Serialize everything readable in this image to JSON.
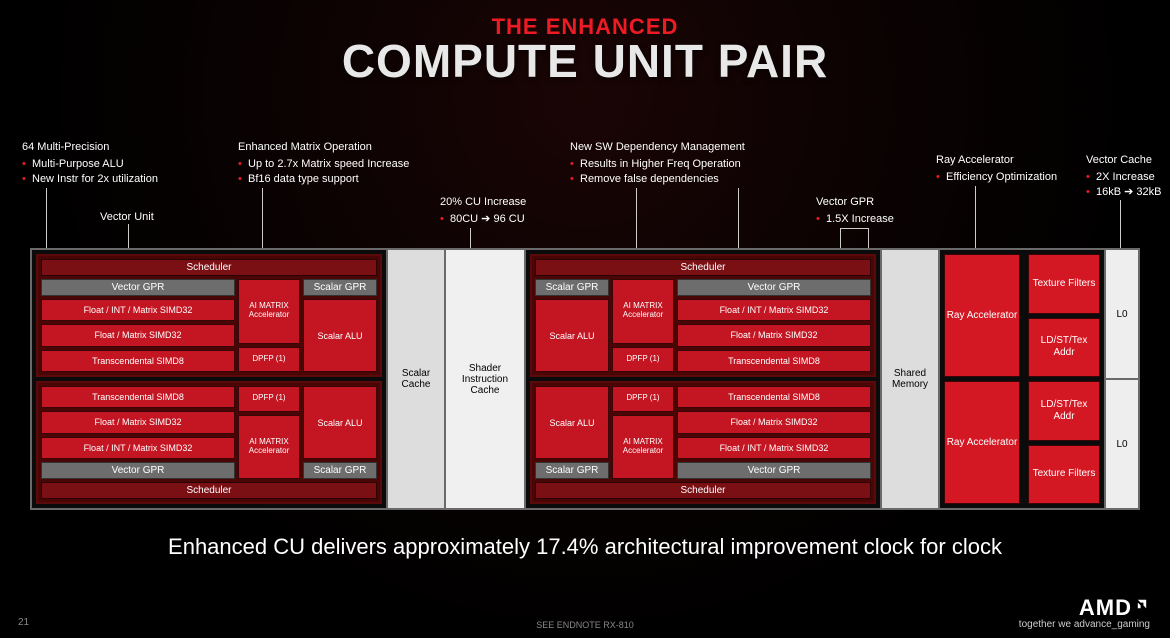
{
  "title": {
    "line1": "THE ENHANCED",
    "line2": "COMPUTE UNIT PAIR"
  },
  "annotations": {
    "alu": {
      "heading": "64 Multi-Precision",
      "items": [
        "Multi-Purpose ALU",
        "New Instr for 2x utilization"
      ]
    },
    "vector_unit": "Vector Unit",
    "matrix": {
      "heading": "Enhanced Matrix Operation",
      "items": [
        "Up to 2.7x Matrix speed Increase",
        "Bf16 data type support"
      ]
    },
    "cu": {
      "heading": "20% CU Increase",
      "items": [
        "80CU ➔ 96 CU"
      ]
    },
    "sw": {
      "heading": "New SW Dependency Management",
      "items": [
        "Results in Higher Freq Operation",
        "Remove false dependencies"
      ]
    },
    "vgpr": {
      "heading": "Vector GPR",
      "items": [
        "1.5X Increase"
      ]
    },
    "ray": {
      "heading": "Ray Accelerator",
      "items": [
        "Efficiency Optimization"
      ]
    },
    "vcache": {
      "heading": "Vector Cache",
      "items": [
        "2X Increase",
        "16kB ➔ 32kB"
      ]
    }
  },
  "blocks": {
    "scheduler": "Scheduler",
    "vector_gpr": "Vector GPR",
    "scalar_gpr": "Scalar GPR",
    "scalar_alu": "Scalar ALU",
    "float_int_matrix": "Float / INT / Matrix SIMD32",
    "float_matrix": "Float / Matrix SIMD32",
    "transcendental": "Transcendental SIMD8",
    "ai_matrix": "AI MATRIX Accelerator",
    "dpfp": "DPFP (1)",
    "scalar_cache": "Scalar Cache",
    "shader_instr": "Shader Instruction Cache",
    "shared_mem": "Shared Memory",
    "ray_accel": "Ray Accelerator",
    "tex_filters": "Texture Filters",
    "ldst": "LD/ST/Tex Addr",
    "l0": "L0"
  },
  "footer": {
    "main": "Enhanced CU delivers approximately 17.4% architectural improvement clock for clock",
    "endnote": "SEE ENDNOTE RX-810",
    "page": "21",
    "logo": "AMD",
    "tagline": "together we advance_gaming"
  }
}
